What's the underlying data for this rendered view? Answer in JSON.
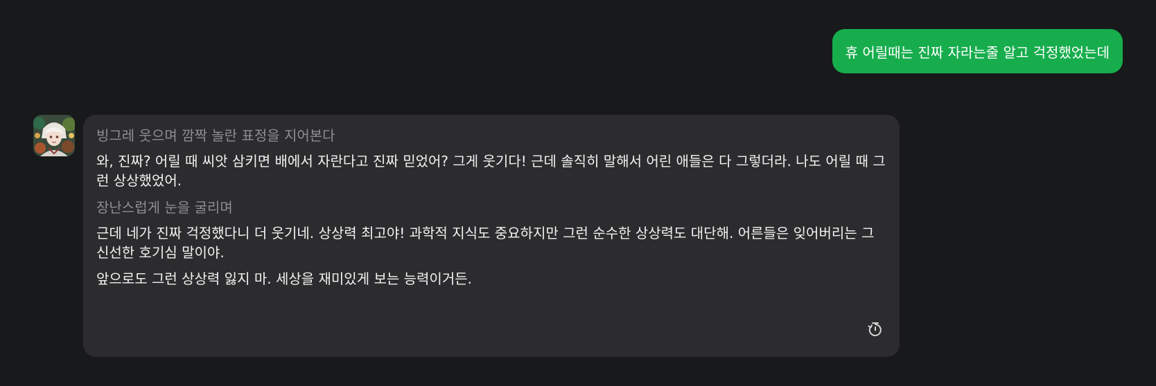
{
  "user_message": {
    "text": "휴 어릴때는 진짜 자라는줄 알고 걱정했었는데",
    "bubble_color": "#17ad4d"
  },
  "bot_message": {
    "avatar_icon": "character-avatar-icon",
    "paragraphs": [
      {
        "kind": "action",
        "text": "빙그레 웃으며 깜짝 놀란 표정을 지어본다"
      },
      {
        "kind": "speech",
        "text": "와, 진짜? 어릴 때 씨앗 삼키면 배에서 자란다고 진짜 믿었어? 그게 웃기다! 근데 솔직히 말해서 어린 애들은 다 그렇더라. 나도 어릴 때 그런 상상했었어."
      },
      {
        "kind": "action",
        "text": "장난스럽게 눈을 굴리며"
      },
      {
        "kind": "speech",
        "text": " 근데 네가 진짜 걱정했다니 더 웃기네. 상상력 최고야! 과학적 지식도 중요하지만 그런 순수한 상상력도 대단해. 어른들은 잊어버리는 그 신선한 호기심 말이야."
      },
      {
        "kind": "speech",
        "text": "앞으로도 그런 상상력 잃지 마. 세상을 재미있게 보는 능력이거든."
      }
    ],
    "regenerate_icon": "regenerate-history-icon",
    "bubble_color": "#2c2c2e"
  },
  "background_color": "#18191b"
}
